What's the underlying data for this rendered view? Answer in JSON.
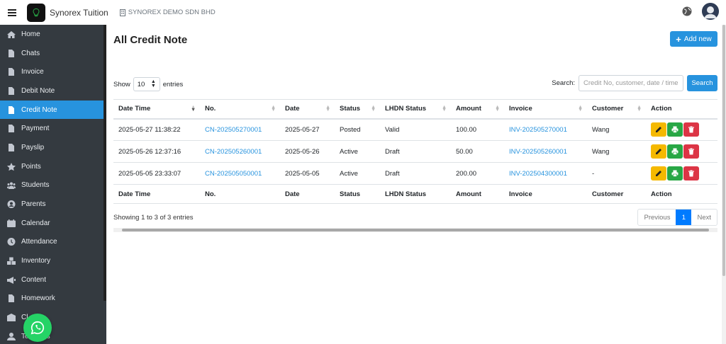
{
  "header": {
    "brand": "Synorex Tuition",
    "company": "SYNOREX DEMO SDN BHD"
  },
  "sidebar": {
    "items": [
      {
        "label": "Home",
        "icon": "home-icon"
      },
      {
        "label": "Chats",
        "icon": "file-icon"
      },
      {
        "label": "Invoice",
        "icon": "file-icon"
      },
      {
        "label": "Debit Note",
        "icon": "file-icon"
      },
      {
        "label": "Credit Note",
        "icon": "file-icon",
        "active": true
      },
      {
        "label": "Payment",
        "icon": "file-icon"
      },
      {
        "label": "Payslip",
        "icon": "file-icon"
      },
      {
        "label": "Points",
        "icon": "star-icon"
      },
      {
        "label": "Students",
        "icon": "users-icon"
      },
      {
        "label": "Parents",
        "icon": "user-circle-icon"
      },
      {
        "label": "Calendar",
        "icon": "calendar-icon"
      },
      {
        "label": "Attendance",
        "icon": "clock-icon"
      },
      {
        "label": "Inventory",
        "icon": "boxes-icon"
      },
      {
        "label": "Content",
        "icon": "bullhorn-icon"
      },
      {
        "label": "Homework",
        "icon": "file-icon"
      },
      {
        "label": "Cl",
        "icon": "school-icon"
      },
      {
        "label": "Teachers",
        "icon": "user-icon"
      }
    ]
  },
  "main": {
    "title": "All Credit Note",
    "add_label": "Add new",
    "show_label": "Show",
    "entries_value": "10",
    "entries_label": "entries",
    "search_label": "Search:",
    "search_placeholder": "Credit No, customer, date / time",
    "search_button": "Search",
    "columns": [
      "Date Time",
      "No.",
      "Date",
      "Status",
      "LHDN Status",
      "Amount",
      "Invoice",
      "Customer",
      "Action"
    ],
    "rows": [
      {
        "datetime": "2025-05-27 11:38:22",
        "no": "CN-202505270001",
        "date": "2025-05-27",
        "status": "Posted",
        "lhdn": "Valid",
        "amount": "100.00",
        "invoice": "INV-202505270001",
        "customer": "Wang"
      },
      {
        "datetime": "2025-05-26 12:37:16",
        "no": "CN-202505260001",
        "date": "2025-05-26",
        "status": "Active",
        "lhdn": "Draft",
        "amount": "50.00",
        "invoice": "INV-202505260001",
        "customer": "Wang"
      },
      {
        "datetime": "2025-05-05 23:33:07",
        "no": "CN-202505050001",
        "date": "2025-05-05",
        "status": "Active",
        "lhdn": "Draft",
        "amount": "200.00",
        "invoice": "INV-202504300001",
        "customer": "-"
      }
    ],
    "info": "Showing 1 to 3 of 3 entries",
    "pager": {
      "previous": "Previous",
      "current": "1",
      "next": "Next"
    }
  },
  "colors": {
    "primary": "#2793de",
    "sidebar": "#343a40",
    "edit": "#f5b900",
    "print": "#28a745",
    "delete": "#dc3545"
  }
}
